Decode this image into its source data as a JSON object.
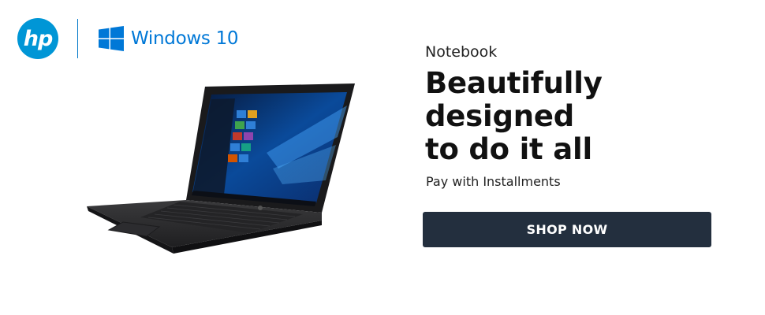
{
  "brand": {
    "hp_logo_text": "hp",
    "windows_text": "Windows 10",
    "icons": [
      "hp-logo-icon",
      "windows-flag-icon"
    ]
  },
  "hero": {
    "category": "Notebook",
    "headline_line1": "Beautifully designed",
    "headline_line2": "to do it all",
    "subtext": "Pay with Installments"
  },
  "cta": {
    "label": "SHOP NOW"
  },
  "colors": {
    "hp_blue": "#0096d6",
    "windows_blue": "#0078d7",
    "cta_bg": "#232f3e",
    "cta_text": "#ffffff"
  }
}
